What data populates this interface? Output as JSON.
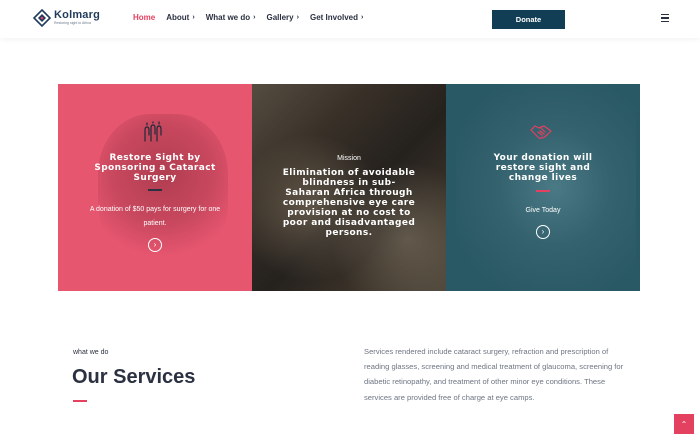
{
  "brand": {
    "name": "Kolmarg",
    "tagline": "Restoring sight to Africa"
  },
  "nav": {
    "items": [
      {
        "label": "Home",
        "caret": ""
      },
      {
        "label": "About",
        "caret": "›"
      },
      {
        "label": "What we do",
        "caret": "›"
      },
      {
        "label": "Gallery",
        "caret": "›"
      },
      {
        "label": "Get Involved",
        "caret": "›"
      }
    ],
    "donate_label": "Donate"
  },
  "cards": [
    {
      "title": "Restore Sight by Sponsoring a Cataract Surgery",
      "desc": "A donation of $50 pays for surgery for one patient.",
      "icon": "raised-hands-icon",
      "arrow": "›"
    },
    {
      "small": "Mission",
      "title": "Elimination of avoidable blindness in sub-Saharan Africa through comprehensive eye care provision at no cost to poor and disadvantaged persons."
    },
    {
      "title": "Your donation will restore sight and change lives",
      "desc": "Give Today",
      "icon": "handshake-icon",
      "arrow": "›"
    }
  ],
  "services": {
    "subtitle": "what we do",
    "title": "Our Services",
    "text": "Services rendered include cataract surgery, refraction and prescription of reading glasses, screening and medical treatment of glaucoma, screening for diabetic retinopathy, and treatment of other minor eye conditions. These services are provided free of charge at eye camps."
  },
  "scroll_top": "⌃",
  "colors": {
    "accent": "#e4405f",
    "navy": "#123e55",
    "card_pink": "#e7566f",
    "card_teal": "#2a5966"
  }
}
